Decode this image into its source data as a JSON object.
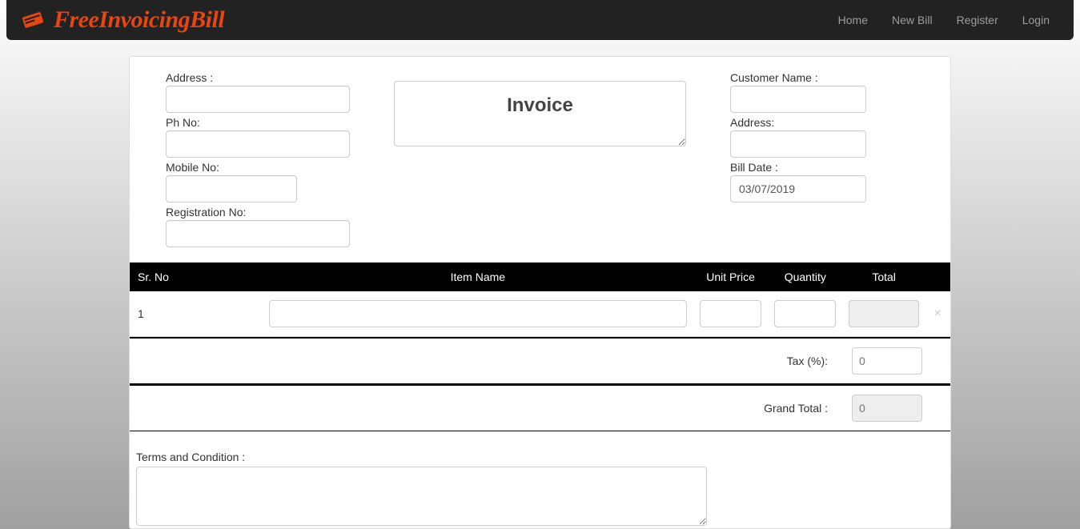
{
  "brand": {
    "text": "FreeInvoicingBill"
  },
  "nav": {
    "home": "Home",
    "newbill": "New Bill",
    "register": "Register",
    "login": "Login"
  },
  "seller": {
    "address_label": "Address :",
    "address_value": "",
    "phone_label": "Ph No:",
    "phone_value": "",
    "mobile_label": "Mobile No:",
    "mobile_value": "",
    "reg_label": "Registration No:",
    "reg_value": ""
  },
  "center": {
    "invoice_title": "Invoice"
  },
  "customer": {
    "name_label": "Customer Name :",
    "name_value": "",
    "address_label": "Address:",
    "address_value": "",
    "date_label": "Bill Date :",
    "date_value": "03/07/2019"
  },
  "table": {
    "headers": {
      "srno": "Sr. No",
      "item": "Item Name",
      "price": "Unit Price",
      "qty": "Quantity",
      "total": "Total"
    },
    "rows": [
      {
        "srno": "1",
        "item": "",
        "price": "",
        "qty": "",
        "total": ""
      }
    ],
    "delete_symbol": "×"
  },
  "summary": {
    "tax_label": "Tax (%):",
    "tax_value": "0",
    "grand_label": "Grand Total :",
    "grand_value": "0"
  },
  "terms": {
    "label": "Terms and Condition :",
    "value": ""
  }
}
